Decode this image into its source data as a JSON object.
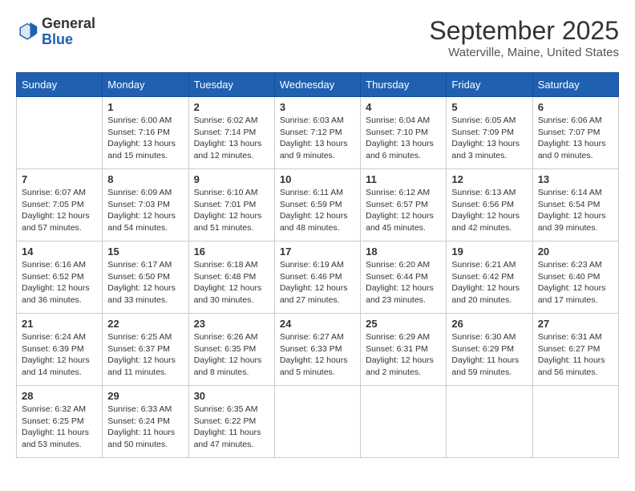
{
  "header": {
    "logo": {
      "general": "General",
      "blue": "Blue"
    },
    "title": "September 2025",
    "location": "Waterville, Maine, United States"
  },
  "weekdays": [
    "Sunday",
    "Monday",
    "Tuesday",
    "Wednesday",
    "Thursday",
    "Friday",
    "Saturday"
  ],
  "weeks": [
    [
      {
        "day": "",
        "info": ""
      },
      {
        "day": "1",
        "info": "Sunrise: 6:00 AM\nSunset: 7:16 PM\nDaylight: 13 hours\nand 15 minutes."
      },
      {
        "day": "2",
        "info": "Sunrise: 6:02 AM\nSunset: 7:14 PM\nDaylight: 13 hours\nand 12 minutes."
      },
      {
        "day": "3",
        "info": "Sunrise: 6:03 AM\nSunset: 7:12 PM\nDaylight: 13 hours\nand 9 minutes."
      },
      {
        "day": "4",
        "info": "Sunrise: 6:04 AM\nSunset: 7:10 PM\nDaylight: 13 hours\nand 6 minutes."
      },
      {
        "day": "5",
        "info": "Sunrise: 6:05 AM\nSunset: 7:09 PM\nDaylight: 13 hours\nand 3 minutes."
      },
      {
        "day": "6",
        "info": "Sunrise: 6:06 AM\nSunset: 7:07 PM\nDaylight: 13 hours\nand 0 minutes."
      }
    ],
    [
      {
        "day": "7",
        "info": "Sunrise: 6:07 AM\nSunset: 7:05 PM\nDaylight: 12 hours\nand 57 minutes."
      },
      {
        "day": "8",
        "info": "Sunrise: 6:09 AM\nSunset: 7:03 PM\nDaylight: 12 hours\nand 54 minutes."
      },
      {
        "day": "9",
        "info": "Sunrise: 6:10 AM\nSunset: 7:01 PM\nDaylight: 12 hours\nand 51 minutes."
      },
      {
        "day": "10",
        "info": "Sunrise: 6:11 AM\nSunset: 6:59 PM\nDaylight: 12 hours\nand 48 minutes."
      },
      {
        "day": "11",
        "info": "Sunrise: 6:12 AM\nSunset: 6:57 PM\nDaylight: 12 hours\nand 45 minutes."
      },
      {
        "day": "12",
        "info": "Sunrise: 6:13 AM\nSunset: 6:56 PM\nDaylight: 12 hours\nand 42 minutes."
      },
      {
        "day": "13",
        "info": "Sunrise: 6:14 AM\nSunset: 6:54 PM\nDaylight: 12 hours\nand 39 minutes."
      }
    ],
    [
      {
        "day": "14",
        "info": "Sunrise: 6:16 AM\nSunset: 6:52 PM\nDaylight: 12 hours\nand 36 minutes."
      },
      {
        "day": "15",
        "info": "Sunrise: 6:17 AM\nSunset: 6:50 PM\nDaylight: 12 hours\nand 33 minutes."
      },
      {
        "day": "16",
        "info": "Sunrise: 6:18 AM\nSunset: 6:48 PM\nDaylight: 12 hours\nand 30 minutes."
      },
      {
        "day": "17",
        "info": "Sunrise: 6:19 AM\nSunset: 6:46 PM\nDaylight: 12 hours\nand 27 minutes."
      },
      {
        "day": "18",
        "info": "Sunrise: 6:20 AM\nSunset: 6:44 PM\nDaylight: 12 hours\nand 23 minutes."
      },
      {
        "day": "19",
        "info": "Sunrise: 6:21 AM\nSunset: 6:42 PM\nDaylight: 12 hours\nand 20 minutes."
      },
      {
        "day": "20",
        "info": "Sunrise: 6:23 AM\nSunset: 6:40 PM\nDaylight: 12 hours\nand 17 minutes."
      }
    ],
    [
      {
        "day": "21",
        "info": "Sunrise: 6:24 AM\nSunset: 6:39 PM\nDaylight: 12 hours\nand 14 minutes."
      },
      {
        "day": "22",
        "info": "Sunrise: 6:25 AM\nSunset: 6:37 PM\nDaylight: 12 hours\nand 11 minutes."
      },
      {
        "day": "23",
        "info": "Sunrise: 6:26 AM\nSunset: 6:35 PM\nDaylight: 12 hours\nand 8 minutes."
      },
      {
        "day": "24",
        "info": "Sunrise: 6:27 AM\nSunset: 6:33 PM\nDaylight: 12 hours\nand 5 minutes."
      },
      {
        "day": "25",
        "info": "Sunrise: 6:29 AM\nSunset: 6:31 PM\nDaylight: 12 hours\nand 2 minutes."
      },
      {
        "day": "26",
        "info": "Sunrise: 6:30 AM\nSunset: 6:29 PM\nDaylight: 11 hours\nand 59 minutes."
      },
      {
        "day": "27",
        "info": "Sunrise: 6:31 AM\nSunset: 6:27 PM\nDaylight: 11 hours\nand 56 minutes."
      }
    ],
    [
      {
        "day": "28",
        "info": "Sunrise: 6:32 AM\nSunset: 6:25 PM\nDaylight: 11 hours\nand 53 minutes."
      },
      {
        "day": "29",
        "info": "Sunrise: 6:33 AM\nSunset: 6:24 PM\nDaylight: 11 hours\nand 50 minutes."
      },
      {
        "day": "30",
        "info": "Sunrise: 6:35 AM\nSunset: 6:22 PM\nDaylight: 11 hours\nand 47 minutes."
      },
      {
        "day": "",
        "info": ""
      },
      {
        "day": "",
        "info": ""
      },
      {
        "day": "",
        "info": ""
      },
      {
        "day": "",
        "info": ""
      }
    ]
  ]
}
